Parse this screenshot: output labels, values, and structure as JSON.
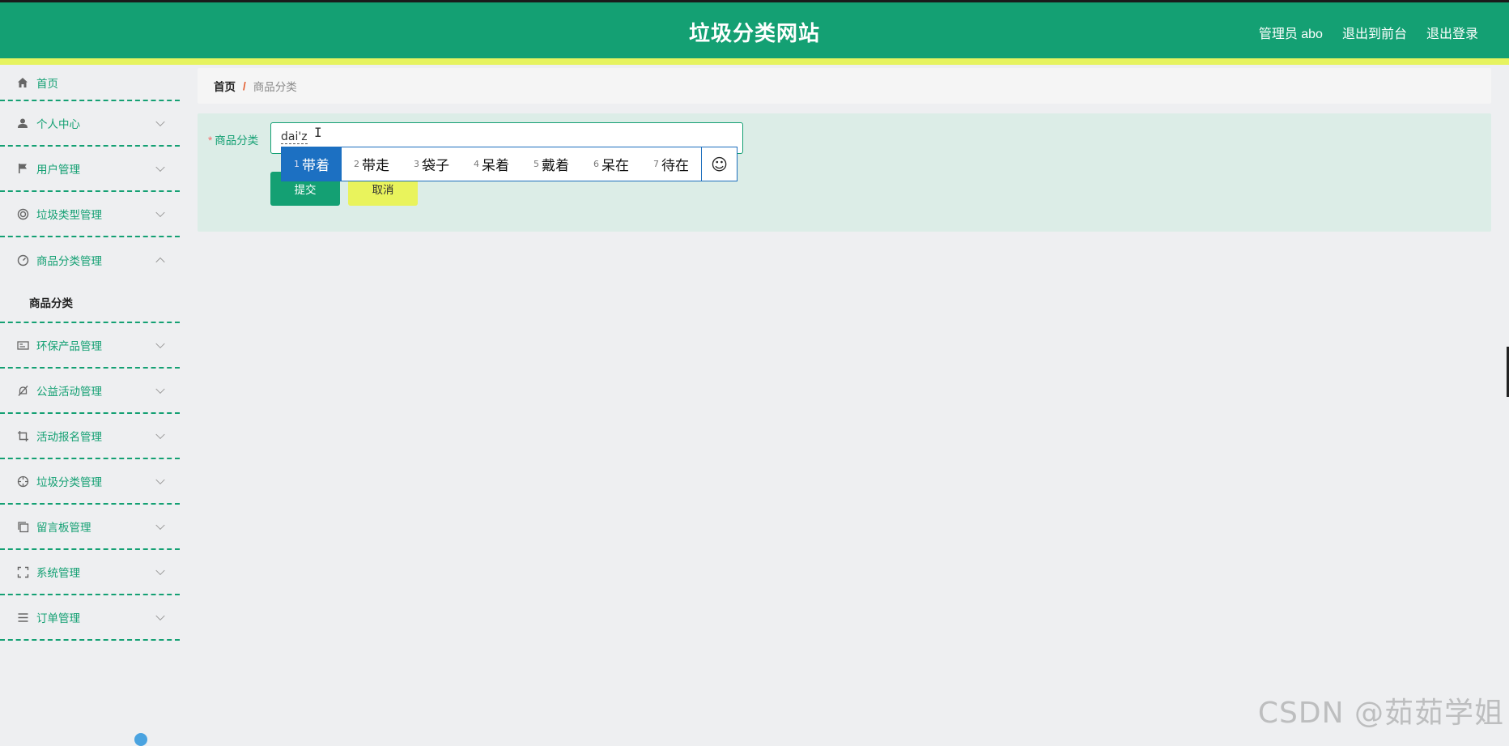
{
  "header": {
    "title": "垃圾分类网站",
    "admin_label": "管理员 abo",
    "to_front": "退出到前台",
    "logout": "退出登录"
  },
  "sidebar": {
    "items": [
      {
        "label": "首页",
        "icon": "home-icon"
      },
      {
        "label": "个人中心",
        "icon": "user-icon"
      },
      {
        "label": "用户管理",
        "icon": "flag-icon"
      },
      {
        "label": "垃圾类型管理",
        "icon": "lifebuoy-icon"
      },
      {
        "label": "商品分类管理",
        "icon": "gauge-icon",
        "expanded": true,
        "children": [
          {
            "label": "商品分类"
          }
        ]
      },
      {
        "label": "环保产品管理",
        "icon": "card-icon"
      },
      {
        "label": "公益活动管理",
        "icon": "bell-off-icon"
      },
      {
        "label": "活动报名管理",
        "icon": "crop-icon"
      },
      {
        "label": "垃圾分类管理",
        "icon": "target-icon"
      },
      {
        "label": "留言板管理",
        "icon": "copy-icon"
      },
      {
        "label": "系统管理",
        "icon": "fullscreen-icon"
      },
      {
        "label": "订单管理",
        "icon": "list-icon"
      }
    ]
  },
  "breadcrumb": {
    "home": "首页",
    "separator": "/",
    "current": "商品分类"
  },
  "form": {
    "required_mark": "*",
    "label": "商品分类",
    "input_value": "dai'z",
    "submit_label": "提交",
    "cancel_label": "取消"
  },
  "ime": {
    "candidates": [
      {
        "num": "1",
        "text": "带着"
      },
      {
        "num": "2",
        "text": "带走"
      },
      {
        "num": "3",
        "text": "袋子"
      },
      {
        "num": "4",
        "text": "呆着"
      },
      {
        "num": "5",
        "text": "戴着"
      },
      {
        "num": "6",
        "text": "呆在"
      },
      {
        "num": "7",
        "text": "待在"
      }
    ],
    "emoji_glyph": "☺"
  },
  "watermark": "CSDN @茹茹学姐",
  "colors": {
    "primary": "#14a073",
    "accent_yellow": "#e6f35f",
    "ime_select": "#1c70c2"
  }
}
